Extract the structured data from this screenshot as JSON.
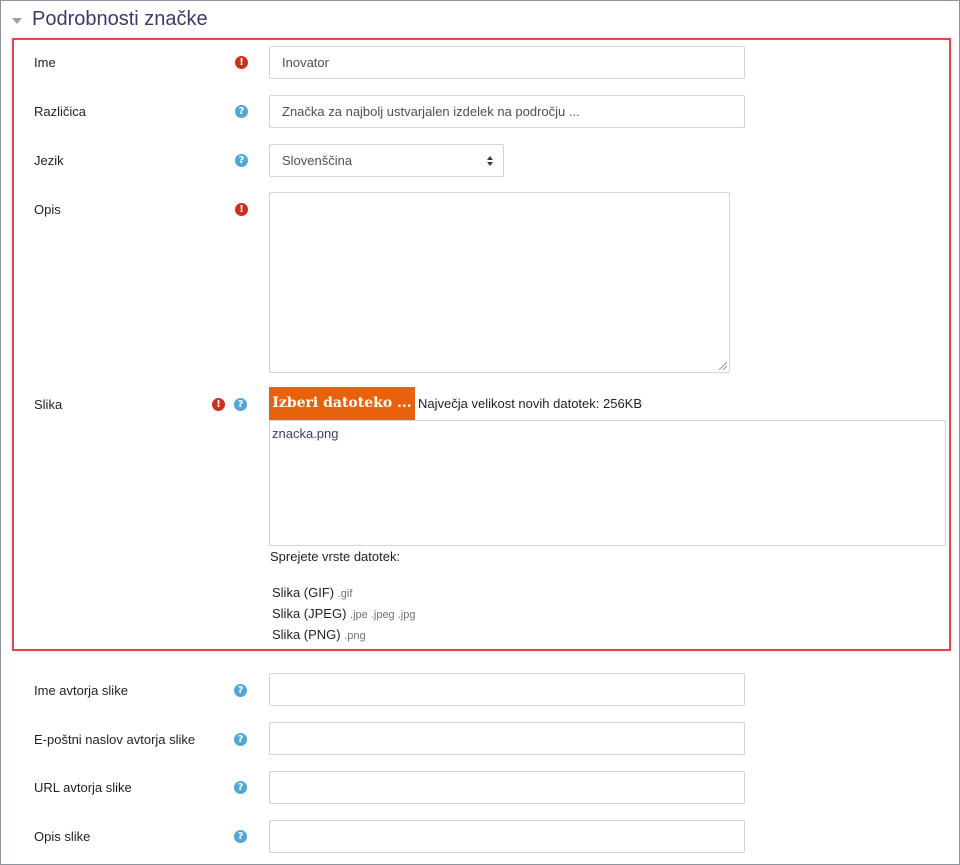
{
  "section": {
    "title": "Podrobnosti značke"
  },
  "fields": {
    "name": {
      "label": "Ime",
      "value": "Inovator"
    },
    "version": {
      "label": "Različica",
      "value": "Značka za najbolj ustvarjalen izdelek na področju ..."
    },
    "language": {
      "label": "Jezik",
      "value": "Slovenščina"
    },
    "description": {
      "label": "Opis",
      "value": ""
    },
    "image": {
      "label": "Slika",
      "button_label": "Izberi datoteko ...",
      "max_size_text": "Največja velikost novih datotek: 256KB",
      "file_name": "znacka.png",
      "accepted_title": "Sprejete vrste datotek:",
      "accepted_types": [
        {
          "name": "Slika (GIF)",
          "ext": ".gif"
        },
        {
          "name": "Slika (JPEG)",
          "ext": ".jpe .jpeg .jpg"
        },
        {
          "name": "Slika (PNG)",
          "ext": ".png"
        }
      ]
    },
    "image_author_name": {
      "label": "Ime avtorja slike",
      "value": ""
    },
    "image_author_email": {
      "label": "E-poštni naslov avtorja slike",
      "value": ""
    },
    "image_author_url": {
      "label": "URL avtorja slike",
      "value": ""
    },
    "image_caption": {
      "label": "Opis slike",
      "value": ""
    }
  },
  "icons": {
    "required": "exclamation-icon",
    "help": "question-icon"
  },
  "colors": {
    "required": "#ca3120",
    "help": "#51a7d6",
    "button": "#e8620b",
    "highlight": "#e2474b",
    "title": "#3d3a6b"
  }
}
